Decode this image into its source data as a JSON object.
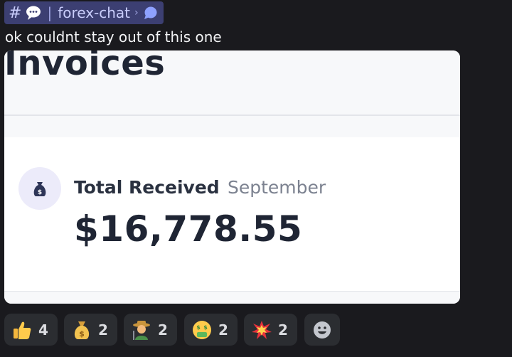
{
  "channel": {
    "hash_symbol": "#",
    "separator": "|",
    "name": "forex-chat",
    "chevron": "›"
  },
  "message": {
    "text": "ok couldnt stay out of this one"
  },
  "embed": {
    "title": "Invoices",
    "total_label": "Total Received",
    "period": "September",
    "amount": "$16,778.55",
    "icon": "money-bag-icon"
  },
  "reactions": [
    {
      "emoji": "thumbs-up",
      "count": "4"
    },
    {
      "emoji": "money-bag",
      "count": "2"
    },
    {
      "emoji": "farmer",
      "count": "2"
    },
    {
      "emoji": "money-mouth-face",
      "count": "2"
    },
    {
      "emoji": "collision",
      "count": "2"
    }
  ],
  "colors": {
    "background": "#1a1a1e",
    "channel_pill": "#3c3f72",
    "reaction_bg": "#2b2d31"
  }
}
